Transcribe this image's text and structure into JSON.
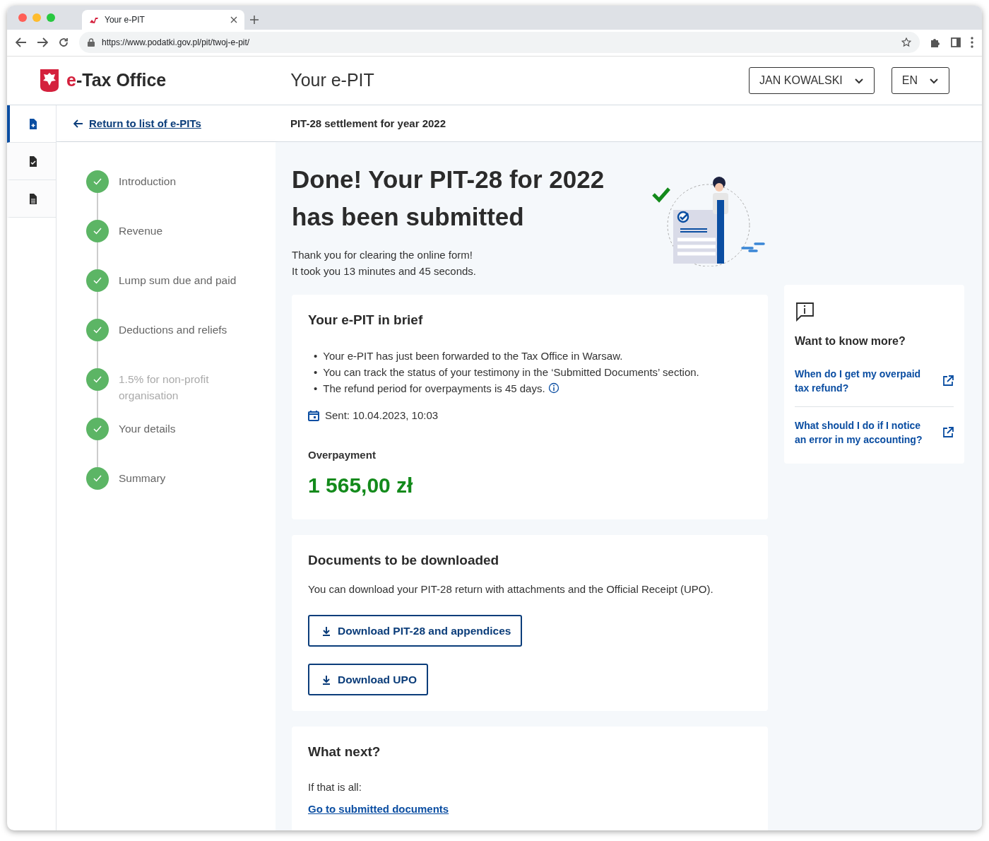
{
  "browser": {
    "tab_title": "Your e-PIT",
    "url": "https://www.podatki.gov.pl/pit/twoj-e-pit/"
  },
  "header": {
    "logo_accent": "e",
    "logo_rest": "-Tax Office",
    "page_title": "Your e-PIT",
    "user_menu": "JAN KOWALSKI",
    "language": "EN"
  },
  "side_nav": [
    {
      "kind": "new",
      "selected": true
    },
    {
      "kind": "checked",
      "selected": false
    },
    {
      "kind": "list",
      "selected": false
    }
  ],
  "subheader": {
    "back_link": "Return to list of e-PITs",
    "title": "PIT-28 settlement for year 2022"
  },
  "steps": [
    {
      "label": "Introduction",
      "done": true,
      "disabled": false
    },
    {
      "label": "Revenue",
      "done": true,
      "disabled": false
    },
    {
      "label": "Lump sum due and paid",
      "done": true,
      "disabled": false
    },
    {
      "label": "Deductions and reliefs",
      "done": true,
      "disabled": false
    },
    {
      "label": "1.5% for non-profit organisation",
      "done": true,
      "disabled": true
    },
    {
      "label": "Your details",
      "done": true,
      "disabled": false
    },
    {
      "label": "Summary",
      "done": true,
      "disabled": false
    }
  ],
  "hero": {
    "title": "Done! Your PIT-28 for 2022 has been submitted",
    "lines": [
      "Thank you for clearing the online form!",
      "It took you 13 minutes and 45 seconds."
    ]
  },
  "brief": {
    "title": "Your e-PIT in brief",
    "bullets": [
      {
        "bullet": "•",
        "text": "Your e-PIT has just been forwarded to the Tax Office in Warsaw.",
        "info": false
      },
      {
        "bullet": "•",
        "text": "You can track the status of your testimony in the ‘Submitted Documents’ section.",
        "info": false
      },
      {
        "bullet": "•",
        "text": "The refund period for overpayments is 45 days.",
        "info": true
      }
    ],
    "sent": "Sent: 10.04.2023, 10:03",
    "amount_label": "Overpayment",
    "amount": "1 565,00 zł"
  },
  "documents": {
    "title": "Documents to be downloaded",
    "text": "You can download your PIT-28 return with attachments and the Official Receipt (UPO).",
    "buttons": [
      "Download PIT-28 and appendices",
      "Download UPO"
    ]
  },
  "next": {
    "title": "What next?",
    "text": "If that is all:",
    "link": "Go to submitted documents"
  },
  "info": {
    "title": "Want to know more?",
    "links": [
      "When do I get my overpaid tax refund?",
      "What should I do if I notice an error in my accounting?"
    ]
  }
}
